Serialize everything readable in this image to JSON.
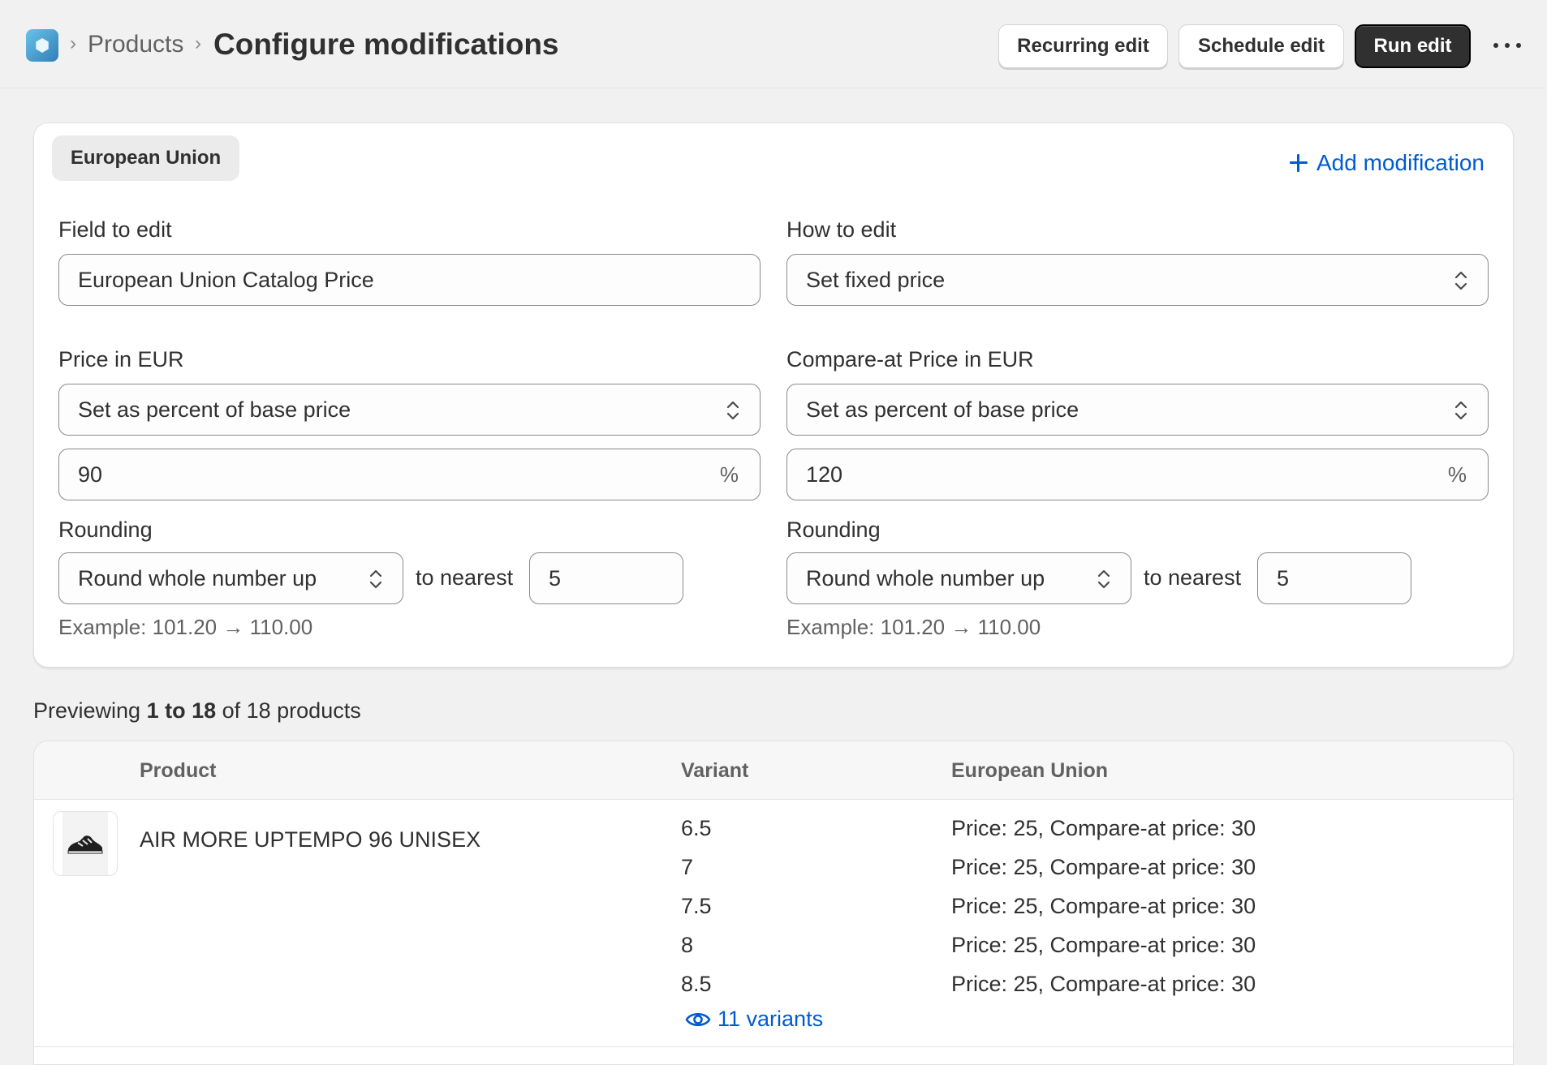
{
  "header": {
    "breadcrumb_parent": "Products",
    "breadcrumb_sep": "›",
    "title": "Configure modifications",
    "buttons": {
      "recurring": "Recurring edit",
      "schedule": "Schedule edit",
      "run": "Run edit"
    }
  },
  "modification": {
    "market_pill": "European Union",
    "add_label": "Add modification",
    "field_to_edit": {
      "label": "Field to edit",
      "value": "European Union Catalog Price"
    },
    "how_to_edit": {
      "label": "How to edit",
      "value": "Set fixed price"
    },
    "price": {
      "label": "Price in EUR",
      "method": "Set as percent of base price",
      "value": "90",
      "suffix": "%",
      "rounding_label": "Rounding",
      "rounding_method": "Round whole number up",
      "to_nearest_label": "to nearest",
      "to_nearest_value": "5",
      "example": "Example: 101.20 → 110.00"
    },
    "compare_price": {
      "label": "Compare-at Price in EUR",
      "method": "Set as percent of base price",
      "value": "120",
      "suffix": "%",
      "rounding_label": "Rounding",
      "rounding_method": "Round whole number up",
      "to_nearest_label": "to nearest",
      "to_nearest_value": "5",
      "example": "Example: 101.20 → 110.00"
    }
  },
  "preview": {
    "prefix": "Previewing ",
    "range": "1 to 18",
    "suffix": " of 18 products"
  },
  "table": {
    "columns": [
      "Product",
      "Variant",
      "European Union"
    ],
    "product_name": "AIR MORE UPTEMPO 96 UNISEX",
    "rows": [
      {
        "variant": "6.5",
        "price": "Price: 25, Compare-at price: 30"
      },
      {
        "variant": "7",
        "price": "Price: 25, Compare-at price: 30"
      },
      {
        "variant": "7.5",
        "price": "Price: 25, Compare-at price: 30"
      },
      {
        "variant": "8",
        "price": "Price: 25, Compare-at price: 30"
      },
      {
        "variant": "8.5",
        "price": "Price: 25, Compare-at price: 30"
      }
    ],
    "variants_link": "11 variants"
  },
  "colors": {
    "accent": "#005bd3",
    "primary_button": "#303030",
    "background": "#f1f1f1"
  },
  "icons": [
    "app-logo-icon",
    "plus-icon",
    "chevron-updown-icon",
    "eye-icon",
    "more-icon",
    "shoe-thumbnail"
  ]
}
